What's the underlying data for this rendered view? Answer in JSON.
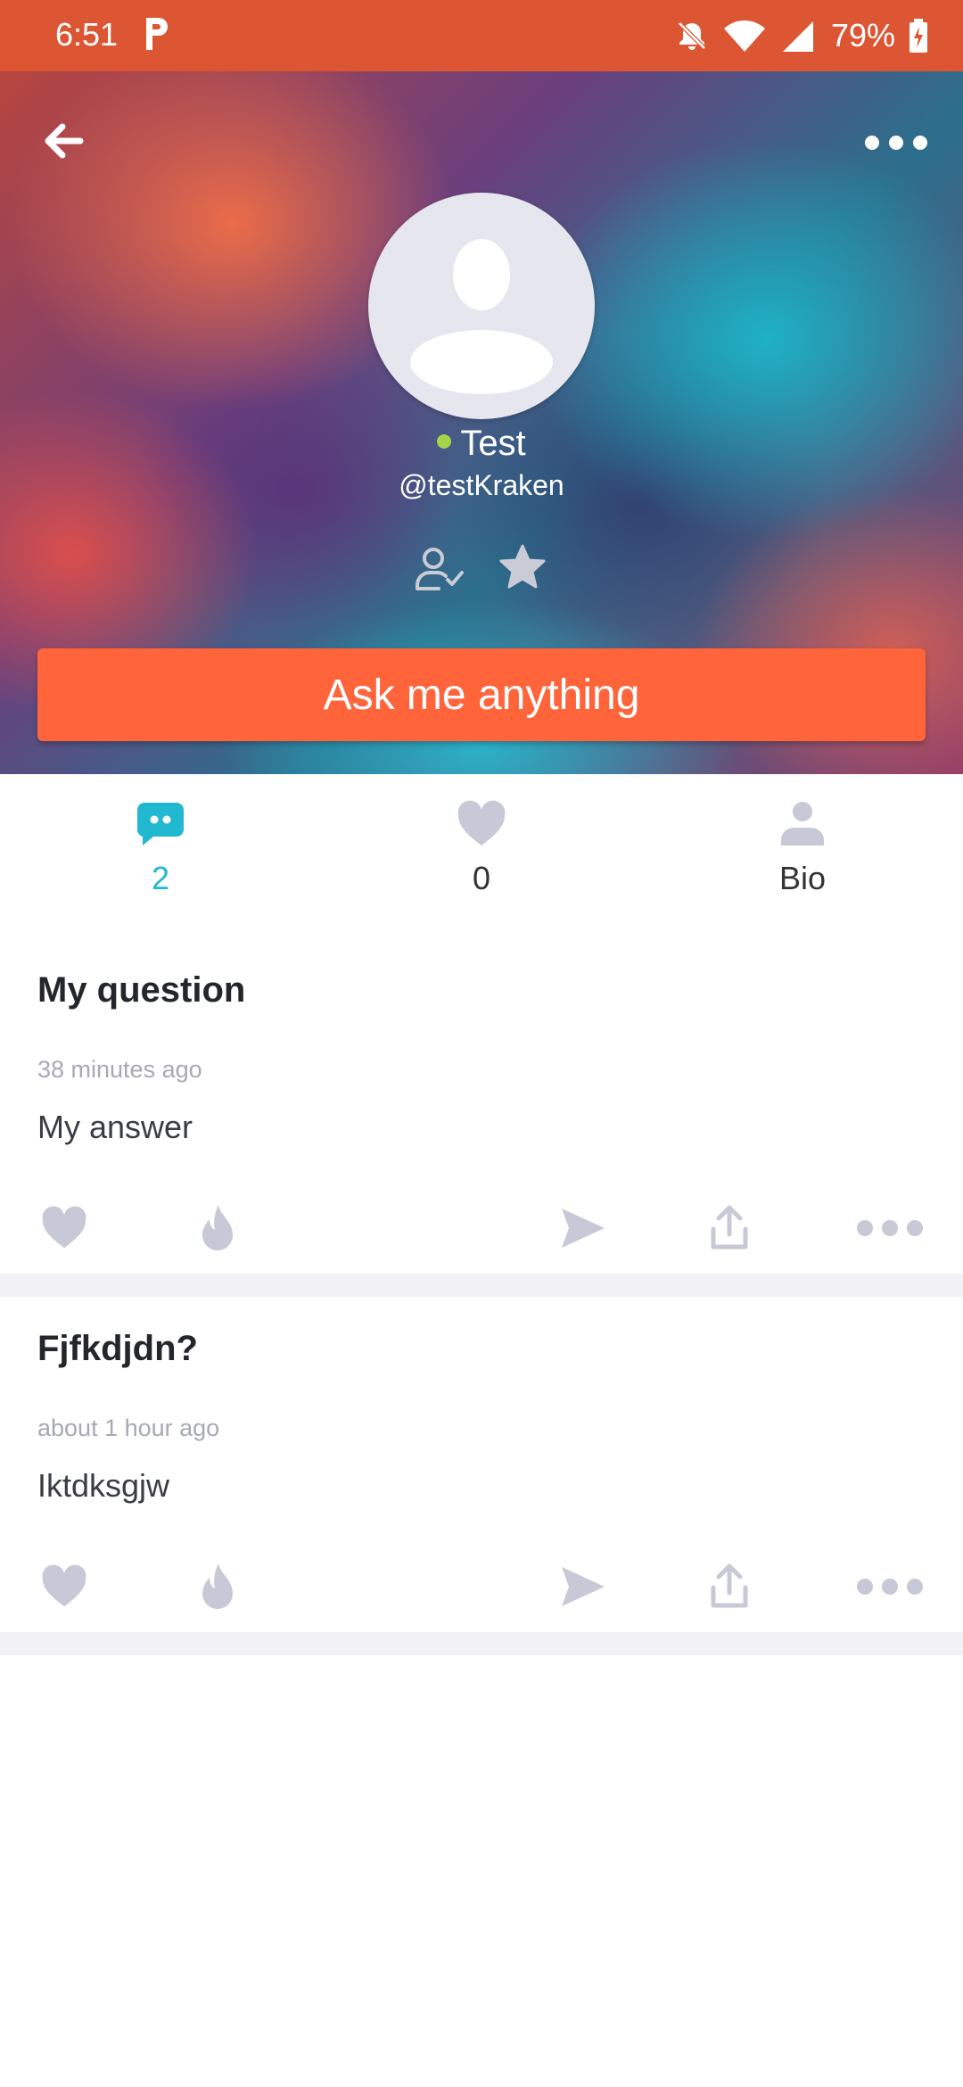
{
  "status_bar": {
    "time": "6:51",
    "app_icon": "p-icon",
    "icons": [
      "bell-off-icon",
      "wifi-icon",
      "signal-icon",
      "battery-charging-icon"
    ],
    "battery": "79%"
  },
  "header": {
    "back_icon": "back-arrow-icon",
    "more_icon": "more-dots-icon",
    "avatar_icon": "avatar-placeholder-icon",
    "name": "Test",
    "online": true,
    "handle": "@testKraken",
    "follow_icon": "follow-user-icon",
    "favorite_icon": "star-icon",
    "ask_button_label": "Ask me anything"
  },
  "tabs": [
    {
      "icon": "answers-bubble-icon",
      "label": "2",
      "active": true
    },
    {
      "icon": "heart-icon",
      "label": "0",
      "active": false
    },
    {
      "icon": "person-icon",
      "label": "Bio",
      "active": false
    }
  ],
  "posts": [
    {
      "question": "My question",
      "time": "38 minutes ago",
      "answer": "My answer"
    },
    {
      "question": "Fjfkdjdn?",
      "time": "about 1 hour ago",
      "answer": "Iktdksgjw"
    }
  ],
  "post_actions": [
    "like-icon",
    "fire-icon",
    "send-icon",
    "share-icon",
    "more-dots-icon"
  ],
  "colors": {
    "status_bar": "#dc5634",
    "accent": "#ff643b",
    "active_tab": "#22b8cf",
    "icon_gray": "#c8c9d6",
    "online": "#a6d34a"
  }
}
